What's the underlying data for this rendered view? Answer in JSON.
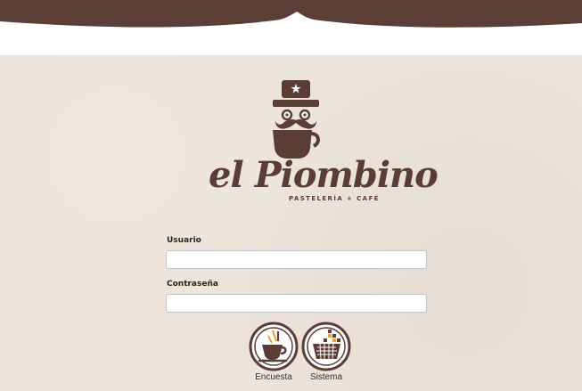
{
  "colors": {
    "brand_brown": "#5a3e35",
    "header_brown": "#5b3f36",
    "background": "#ece3da",
    "accent_orange": "#f0a030"
  },
  "brand": {
    "name": "el Piombino",
    "tagline": "PASTELERÍA + CAFÉ",
    "logo_icon": "mustache-cup-hat-icon"
  },
  "form": {
    "user_label": "Usuario",
    "user_value": "",
    "password_label": "Contraseña",
    "password_value": ""
  },
  "actions": [
    {
      "label": "Encuesta",
      "icon": "coffee-survey-icon"
    },
    {
      "label": "Sistema",
      "icon": "cake-basket-icon"
    }
  ]
}
